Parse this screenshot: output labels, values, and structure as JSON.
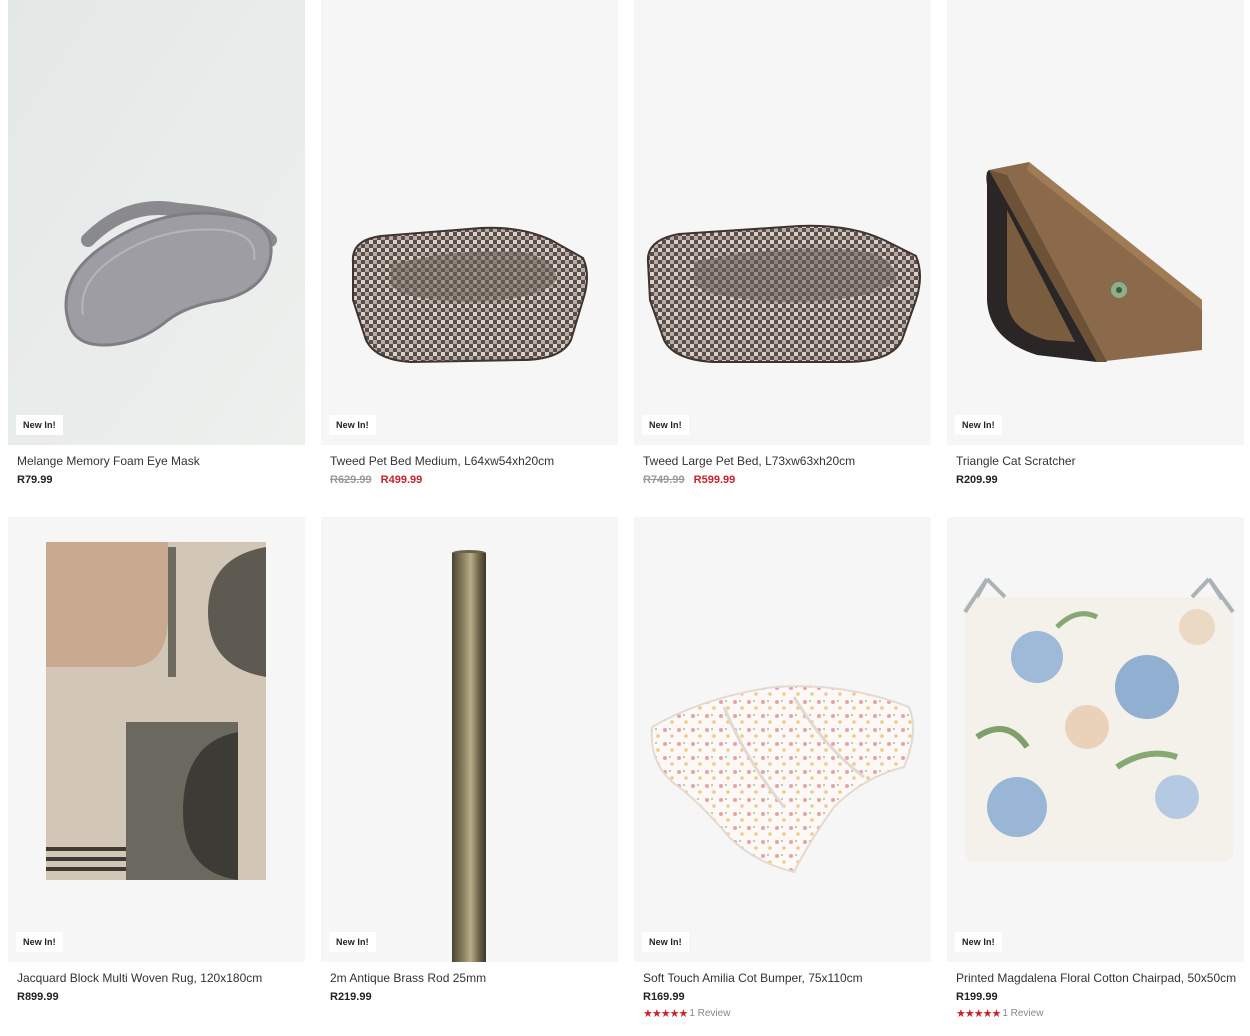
{
  "badge_label": "New In!",
  "products": [
    {
      "name": "Melange Memory Foam Eye Mask",
      "price": "R79.99",
      "icon": "eye-mask-image"
    },
    {
      "name": "Tweed Pet Bed Medium, L64xw54xh20cm",
      "was_price": "R629.99",
      "sale_price": "R499.99",
      "icon": "pet-bed-image"
    },
    {
      "name": "Tweed Large Pet Bed, L73xw63xh20cm",
      "was_price": "R749.99",
      "sale_price": "R599.99",
      "icon": "pet-bed-image"
    },
    {
      "name": "Triangle Cat Scratcher",
      "price": "R209.99",
      "icon": "cat-scratcher-image"
    },
    {
      "name": "Jacquard Block Multi Woven Rug, 120x180cm",
      "price": "R899.99",
      "icon": "rug-image"
    },
    {
      "name": "2m Antique Brass Rod 25mm",
      "price": "R219.99",
      "icon": "curtain-rod-image"
    },
    {
      "name": "Soft Touch Amilia Cot Bumper, 75x110cm",
      "price": "R169.99",
      "rating_stars": 5,
      "review_text": "1 Review",
      "icon": "cot-bumper-image"
    },
    {
      "name": "Printed Magdalena Floral Cotton Chairpad, 50x50cm",
      "price": "R199.99",
      "rating_stars": 5,
      "review_text": "1 Review",
      "icon": "chairpad-image"
    }
  ],
  "colors": {
    "sale": "#c8232c",
    "was": "#9a9a9a",
    "card_bg": "#f6f6f6"
  }
}
